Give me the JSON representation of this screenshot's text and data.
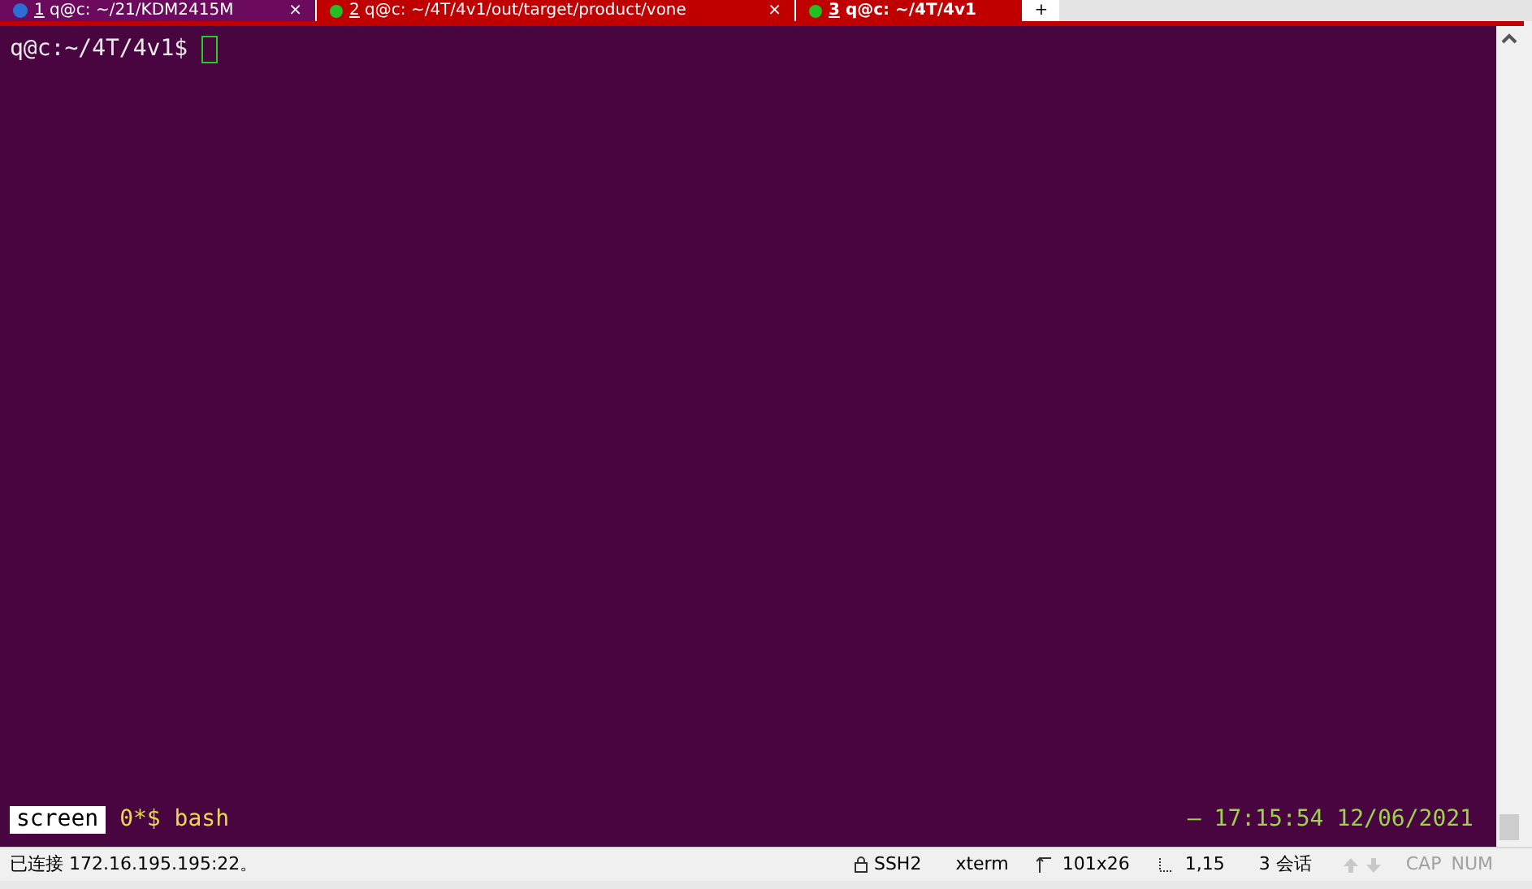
{
  "tabs": [
    {
      "number": "1",
      "title": " q@c: ~/21/KDM2415M",
      "kind": "info",
      "selected": false,
      "close": "×"
    },
    {
      "number": "2",
      "title": " q@c: ~/4T/4v1/out/target/product/vone",
      "kind": "connected",
      "selected": false,
      "close": "×"
    },
    {
      "number": "3",
      "title": " q@c: ~/4T/4v1",
      "kind": "connected",
      "selected": true
    }
  ],
  "new_tab": "+",
  "terminal": {
    "prompt": "q@c:~/4T/4v1$ "
  },
  "screen_bar": {
    "label": "screen",
    "window": "0*$ bash",
    "dash": "—",
    "time": "17:15:54",
    "date": "12/06/2021"
  },
  "status_bar": {
    "connection": "已连接 172.16.195.195:22。",
    "protocol": "SSH2",
    "term": "xterm",
    "size": "101x26",
    "cursor": "1,15",
    "sessions": "3 会话",
    "indicators": [
      {
        "label": "CAP",
        "on": false
      },
      {
        "label": "NUM",
        "on": false
      }
    ]
  }
}
